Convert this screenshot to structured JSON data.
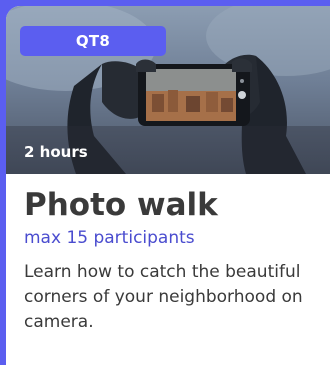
{
  "card": {
    "tag": "QT8",
    "duration": "2 hours",
    "title": "Photo walk",
    "capacity": "max 15 participants",
    "description": "Learn how to catch the beautiful corners of your neighborhood on camera.",
    "image_subject": "hands holding a smartphone taking a photo of a cityscape"
  },
  "colors": {
    "accent": "#5b5ef0",
    "capacity_text": "#4a4ccf",
    "body_text": "#3a3a3a"
  }
}
